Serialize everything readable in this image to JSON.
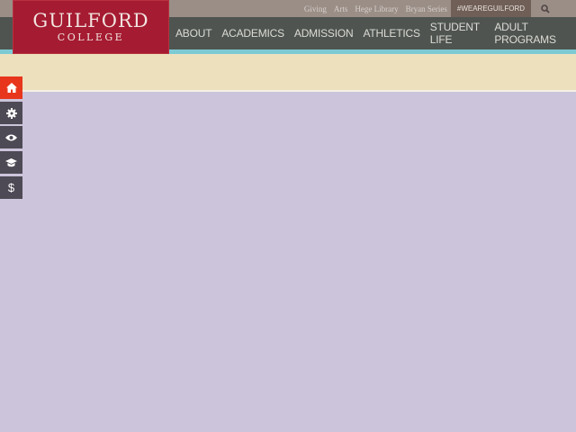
{
  "logo": {
    "line1": "GUILFORD",
    "line2": "COLLEGE"
  },
  "utility": {
    "links": [
      "Giving",
      "Arts",
      "Hege Library",
      "Bryan Series"
    ],
    "hashtag": "#WEAREGUILFORD"
  },
  "nav": [
    "ABOUT",
    "ACADEMICS",
    "ADMISSION",
    "ATHLETICS",
    "STUDENT LIFE",
    "ADULT PROGRAMS"
  ],
  "side_icons": [
    "home-icon",
    "gear-icon",
    "eye-icon",
    "graduation-cap-icon",
    "dollar-icon"
  ],
  "side_dollar": "$",
  "colors": {
    "brand": "#a51b31",
    "active": "#e8361c",
    "accent": "#7ccbd4"
  }
}
